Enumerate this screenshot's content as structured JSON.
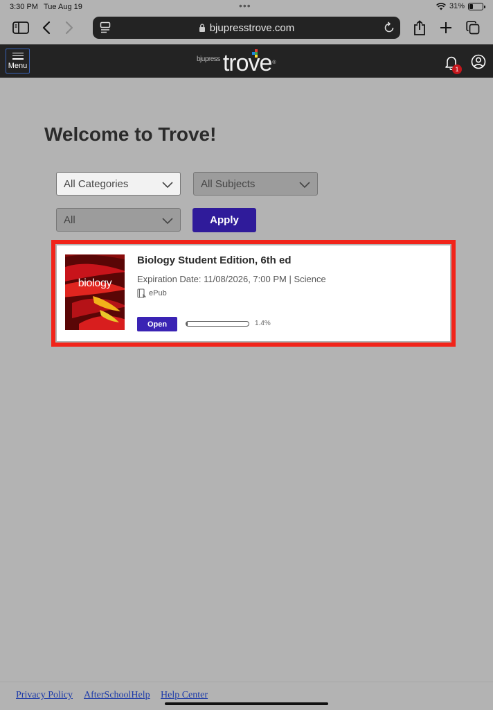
{
  "status_bar": {
    "time": "3:30 PM",
    "date": "Tue Aug 19",
    "battery": "31%",
    "battery_level": 0.31
  },
  "browser": {
    "url": "bjupresstrove.com"
  },
  "header": {
    "menu_label": "Menu",
    "logo_small": "bjupress",
    "logo_big": "trove",
    "notification_count": "1"
  },
  "main": {
    "title": "Welcome to Trove!",
    "filters": {
      "categories": "All Categories",
      "subjects": "All Subjects",
      "status": "All",
      "apply_label": "Apply"
    },
    "books": [
      {
        "cover_title": "biology",
        "title": "Biology Student Edition, 6th ed",
        "meta": "Expiration Date: 11/08/2026, 7:00 PM | Science",
        "format": "ePub",
        "open_label": "Open",
        "progress": 0.014,
        "progress_label": "1.4%"
      }
    ]
  },
  "footer": {
    "links": [
      "Privacy Policy",
      "AfterSchoolHelp",
      "Help Center"
    ]
  },
  "colors": {
    "header_bg": "#232323",
    "primary": "#2f1b9a",
    "highlight": "#f1241a",
    "badge": "#c4161c",
    "link": "#1c3aa9"
  }
}
